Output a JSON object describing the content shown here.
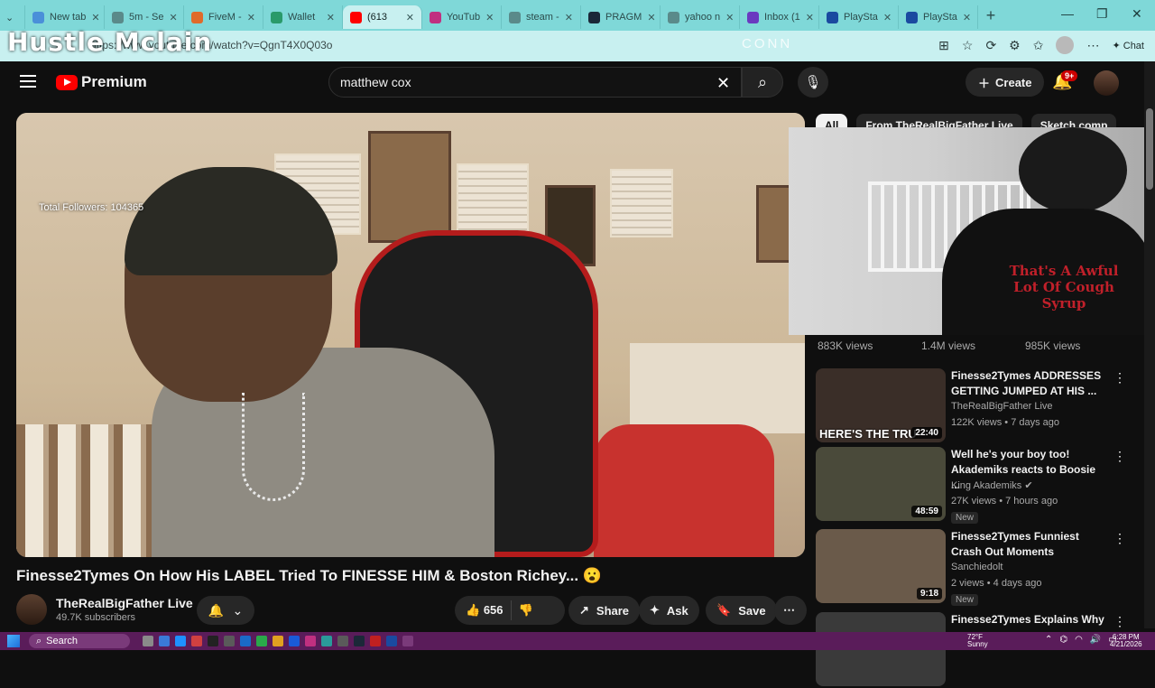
{
  "browser": {
    "tabs": [
      {
        "label": "New tab",
        "color": "#4a90d9"
      },
      {
        "label": "5m - Se",
        "color": "#5a8a8a"
      },
      {
        "label": "FiveM -",
        "color": "#e06a2a"
      },
      {
        "label": "Wallet",
        "color": "#2a9a6a"
      },
      {
        "label": "(613",
        "color": "#ff0000",
        "active": true
      },
      {
        "label": "YouTub",
        "color": "#c03080"
      },
      {
        "label": "steam -",
        "color": "#5a8a8a"
      },
      {
        "label": "PRAGM",
        "color": "#1b2838"
      },
      {
        "label": "yahoo n",
        "color": "#5a8a8a"
      },
      {
        "label": "Inbox (1",
        "color": "#6a3ac0"
      },
      {
        "label": "PlaySta",
        "color": "#1a4aa0"
      },
      {
        "label": "PlaySta",
        "color": "#1a4aa0"
      }
    ],
    "new_tab": "+",
    "window_controls": {
      "minimize": "—",
      "restore": "❐",
      "close": "✕"
    },
    "url": "https://www.youtube.com/watch?v=QgnT4X0Q03o",
    "chat_label": "Chat"
  },
  "overlays": {
    "streamer_name": "Hustle Mclain",
    "conn_text": "CONN",
    "followers": "Total Followers: 104365"
  },
  "youtube": {
    "logo_text": "Premium",
    "search_value": "matthew cox",
    "create_label": "Create",
    "notif_badge": "9+",
    "video_title": "Finesse2Tymes On How His LABEL Tried To FINESSE HIM & Boston Richey... 😮",
    "channel_name": "TheRealBigFather Live",
    "subscribers": "49.7K subscribers",
    "likes": "656",
    "share_label": "Share",
    "ask_label": "Ask",
    "save_label": "Save",
    "chips": [
      {
        "label": "All",
        "selected": true
      },
      {
        "label": "From TheRealBigFather Live",
        "selected": false
      },
      {
        "label": "Sketch comp",
        "selected": false
      }
    ],
    "views_row": [
      "883K views",
      "1.4M views",
      "985K views"
    ],
    "recommendations": [
      {
        "title": "Finesse2Tymes ADDRESSES GETTING JUMPED AT HIS ...",
        "channel": "TheRealBigFather Live",
        "meta": "122K views • 7 days ago",
        "duration": "22:40",
        "new": "",
        "thumb_text": "HERE'S THE TRU"
      },
      {
        "title": "Well he's your boy too! Akademiks reacts to Boosie ...",
        "channel": "King Akademiks ✔",
        "meta": "27K views • 7 hours ago",
        "duration": "48:59",
        "new": "New",
        "thumb_text": ""
      },
      {
        "title": "Finesse2Tymes Funniest Crash Out Moments",
        "channel": "Sanchiedolt",
        "meta": "2 views • 4 days ago",
        "duration": "9:18",
        "new": "New",
        "thumb_text": ""
      },
      {
        "title": "Finesse2Tymes Explains Why",
        "channel": "",
        "meta": "",
        "duration": "",
        "new": "",
        "thumb_text": ""
      }
    ]
  },
  "webcam": {
    "hoodie_text": "That's A Awful Lot Of Cough Syrup"
  },
  "taskbar": {
    "search_label": "Search",
    "weather_temp": "72°F",
    "weather_desc": "Sunny",
    "time": "6:28 PM",
    "date": "4/21/2026"
  }
}
